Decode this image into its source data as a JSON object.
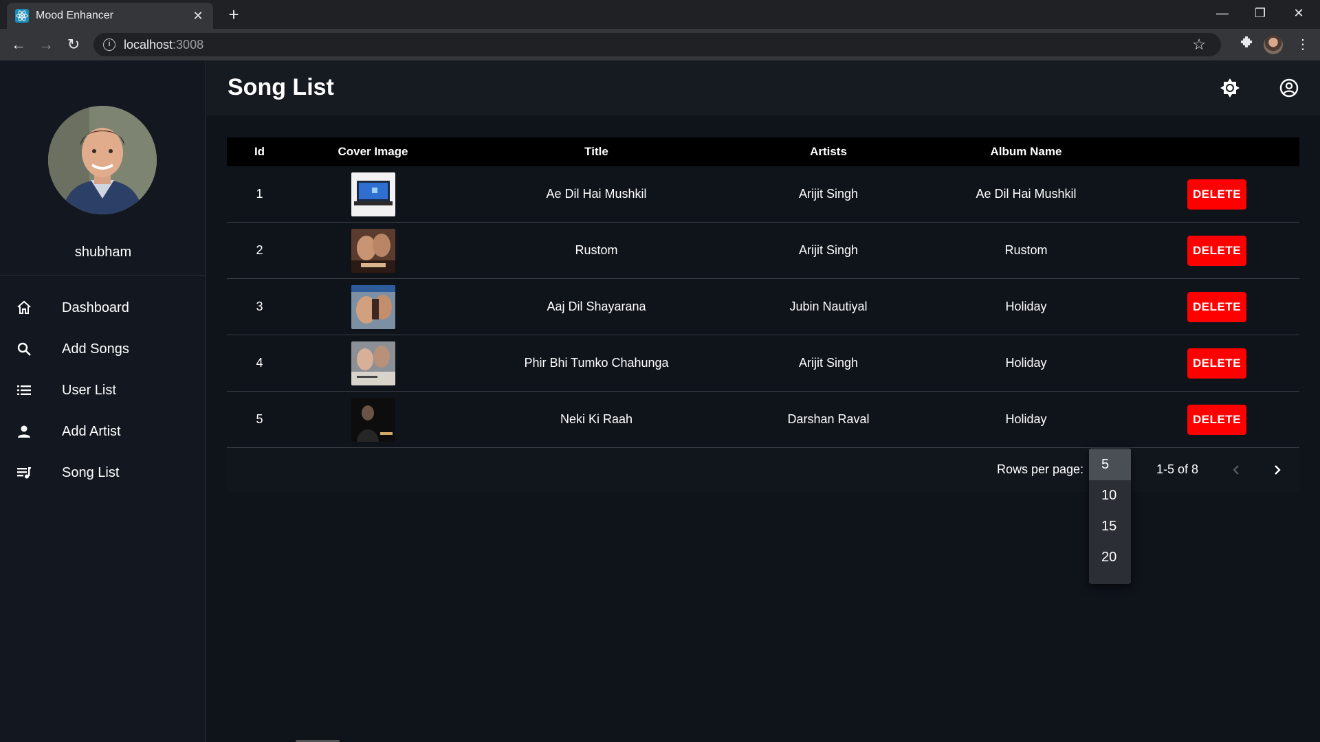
{
  "browser": {
    "tab_title": "Mood Enhancer",
    "url_host": "localhost",
    "url_port": ":3008"
  },
  "sidebar": {
    "username": "shubham",
    "items": [
      {
        "label": "Dashboard",
        "icon": "home-icon"
      },
      {
        "label": "Add Songs",
        "icon": "search-icon"
      },
      {
        "label": "User List",
        "icon": "list-icon"
      },
      {
        "label": "Add Artist",
        "icon": "person-icon"
      },
      {
        "label": "Song List",
        "icon": "queue-music-icon"
      }
    ]
  },
  "header": {
    "title": "Song List"
  },
  "table": {
    "columns": [
      "Id",
      "Cover Image",
      "Title",
      "Artists",
      "Album Name"
    ],
    "delete_label": "DELETE",
    "rows": [
      {
        "id": "1",
        "title": "Ae Dil Hai Mushkil",
        "artists": "Arijit Singh",
        "album": "Ae Dil Hai Mushkil"
      },
      {
        "id": "2",
        "title": "Rustom",
        "artists": "Arijit Singh",
        "album": "Rustom"
      },
      {
        "id": "3",
        "title": "Aaj Dil Shayarana",
        "artists": "Jubin Nautiyal",
        "album": "Holiday"
      },
      {
        "id": "4",
        "title": "Phir Bhi Tumko Chahunga",
        "artists": "Arijit Singh",
        "album": "Holiday"
      },
      {
        "id": "5",
        "title": "Neki Ki Raah",
        "artists": "Darshan Raval",
        "album": "Holiday"
      }
    ]
  },
  "pagination": {
    "rows_per_page_label": "Rows per page:",
    "range": "1-5 of 8",
    "options": [
      "5",
      "10",
      "15",
      "20"
    ],
    "selected": "5"
  },
  "colors": {
    "delete": "#ff0000",
    "background": "#0f131a",
    "sidebar": "#131820"
  }
}
